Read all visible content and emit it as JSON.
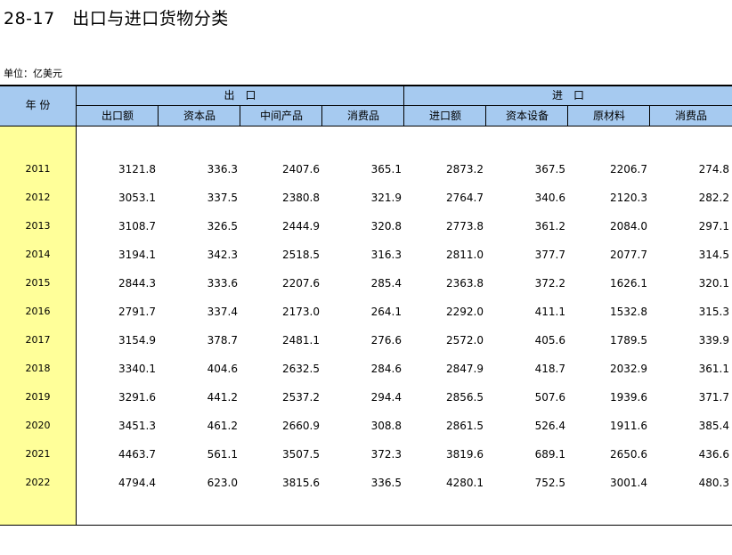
{
  "title": "28-17　出口与进口货物分类",
  "unit": "单位：亿美元",
  "headers": {
    "year": "年 份",
    "export_group": "出　口",
    "import_group": "进　口",
    "columns": [
      "出口额",
      "资本品",
      "中间产品",
      "消费品",
      "进口额",
      "资本设备",
      "原材料",
      "消费品"
    ]
  },
  "rows": [
    {
      "year": "2011",
      "values": [
        "3121.8",
        "336.3",
        "2407.6",
        "365.1",
        "2873.2",
        "367.5",
        "2206.7",
        "274.8"
      ]
    },
    {
      "year": "2012",
      "values": [
        "3053.1",
        "337.5",
        "2380.8",
        "321.9",
        "2764.7",
        "340.6",
        "2120.3",
        "282.2"
      ]
    },
    {
      "year": "2013",
      "values": [
        "3108.7",
        "326.5",
        "2444.9",
        "320.8",
        "2773.8",
        "361.2",
        "2084.0",
        "297.1"
      ]
    },
    {
      "year": "2014",
      "values": [
        "3194.1",
        "342.3",
        "2518.5",
        "316.3",
        "2811.0",
        "377.7",
        "2077.7",
        "314.5"
      ]
    },
    {
      "year": "2015",
      "values": [
        "2844.3",
        "333.6",
        "2207.6",
        "285.4",
        "2363.8",
        "372.2",
        "1626.1",
        "320.1"
      ]
    },
    {
      "year": "2016",
      "values": [
        "2791.7",
        "337.4",
        "2173.0",
        "264.1",
        "2292.0",
        "411.1",
        "1532.8",
        "315.3"
      ]
    },
    {
      "year": "2017",
      "values": [
        "3154.9",
        "378.7",
        "2481.1",
        "276.6",
        "2572.0",
        "405.6",
        "1789.5",
        "339.9"
      ]
    },
    {
      "year": "2018",
      "values": [
        "3340.1",
        "404.6",
        "2632.5",
        "284.6",
        "2847.9",
        "418.7",
        "2032.9",
        "361.1"
      ]
    },
    {
      "year": "2019",
      "values": [
        "3291.6",
        "441.2",
        "2537.2",
        "294.4",
        "2856.5",
        "507.6",
        "1939.6",
        "371.7"
      ]
    },
    {
      "year": "2020",
      "values": [
        "3451.3",
        "461.2",
        "2660.9",
        "308.8",
        "2861.5",
        "526.4",
        "1911.6",
        "385.4"
      ]
    },
    {
      "year": "2021",
      "values": [
        "4463.7",
        "561.1",
        "3507.5",
        "372.3",
        "3819.6",
        "689.1",
        "2650.6",
        "436.6"
      ]
    },
    {
      "year": "2022",
      "values": [
        "4794.4",
        "623.0",
        "3815.6",
        "336.5",
        "4280.1",
        "752.5",
        "3001.4",
        "480.3"
      ]
    }
  ]
}
